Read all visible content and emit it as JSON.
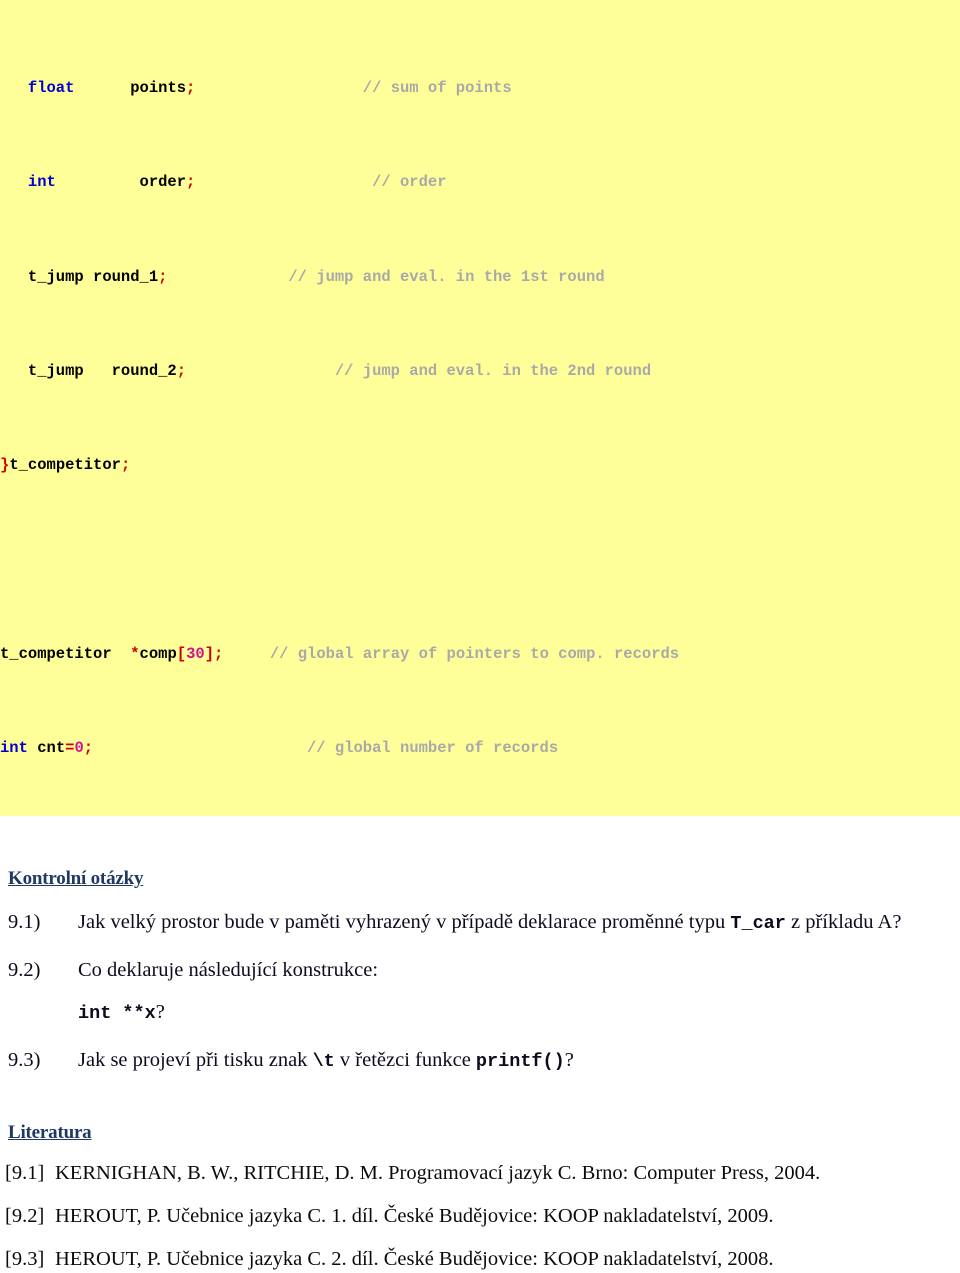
{
  "code_block": {
    "background": "#ffff99",
    "keyword_color": "#0000d0",
    "identifier_color": "#000000",
    "punct_color": "#cc0000",
    "number_color": "#d01090",
    "comment_color": "#a9a9a9",
    "lines": [
      {
        "id": "line-float-points",
        "indent": "   ",
        "keyword": "float",
        "gap1": "      ",
        "identifier": "points",
        "punct": ";",
        "gap2": "                  ",
        "comment": "// sum of points"
      },
      {
        "id": "line-int-order",
        "indent": "   ",
        "keyword": "int",
        "gap1": "         ",
        "identifier": "order",
        "punct": ";",
        "gap2": "                   ",
        "comment": "// order"
      },
      {
        "id": "line-tjump-round1",
        "indent": "   ",
        "keyword": "",
        "gap1": "",
        "identifier": "t_jump round_1",
        "punct": ";",
        "gap2": "             ",
        "comment": "// jump and eval. in the 1st round"
      },
      {
        "id": "line-tjump-round2",
        "indent": "   ",
        "keyword": "",
        "gap1": "",
        "identifier": "t_jump   round_2",
        "punct": ";",
        "gap2": "                ",
        "comment": "// jump and eval. in the 2nd round"
      },
      {
        "id": "line-close-struct",
        "indent": "",
        "keyword": "",
        "gap1": "",
        "identifier": "t_competitor",
        "prefix_punct": "}",
        "punct": ";",
        "gap2": "",
        "comment": ""
      }
    ],
    "global_lines": [
      {
        "id": "line-comp-array",
        "type_name": "t_competitor",
        "gap1": "  ",
        "star": "*",
        "var_name": "comp",
        "bracket_open": "[",
        "array_size": "30",
        "bracket_close": "]",
        "semicolon": ";",
        "gap2": "     ",
        "comment": "// global array of pointers to comp. records"
      },
      {
        "id": "line-cnt",
        "keyword": "int",
        "gap1": " ",
        "var_name": "cnt",
        "assign": "=",
        "value": "0",
        "semicolon": ";",
        "gap2": "                       ",
        "comment": "// global number of records"
      }
    ]
  },
  "questions_section": {
    "heading": "Kontrolní otázky",
    "heading_color": "#1f3864",
    "items": [
      {
        "num": "9.1)",
        "text_before": "Jak velký prostor bude v paměti vyhrazený v případě deklarace proměnné typu ",
        "code": "T_car",
        "text_after": " z příkladu A?",
        "code_on_new_line": false
      },
      {
        "num": "9.2)",
        "text_before": "Co deklaruje následující konstrukce:",
        "code": "int **x",
        "text_after": "?",
        "code_on_new_line": true
      },
      {
        "num": "9.3)",
        "text_before": "Jak se projeví při tisku znak ",
        "code": "\\t",
        "text_mid": " v řetězci funkce ",
        "code2": "printf()",
        "text_after": "?",
        "code_on_new_line": false
      }
    ]
  },
  "literature_section": {
    "heading": "Literatura",
    "heading_color": "#1f3864",
    "items": [
      {
        "num": "[9.1]",
        "text": "KERNIGHAN, B. W., RITCHIE, D. M. Programovací jazyk C. Brno: Computer Press, 2004."
      },
      {
        "num": "[9.2]",
        "text": "HEROUT, P. Učebnice jazyka C. 1. díl. České Budějovice: KOOP nakladatelství, 2009."
      },
      {
        "num": "[9.3]",
        "text": "HEROUT, P. Učebnice jazyka C. 2. díl. České Budějovice: KOOP nakladatelství, 2008."
      }
    ]
  }
}
